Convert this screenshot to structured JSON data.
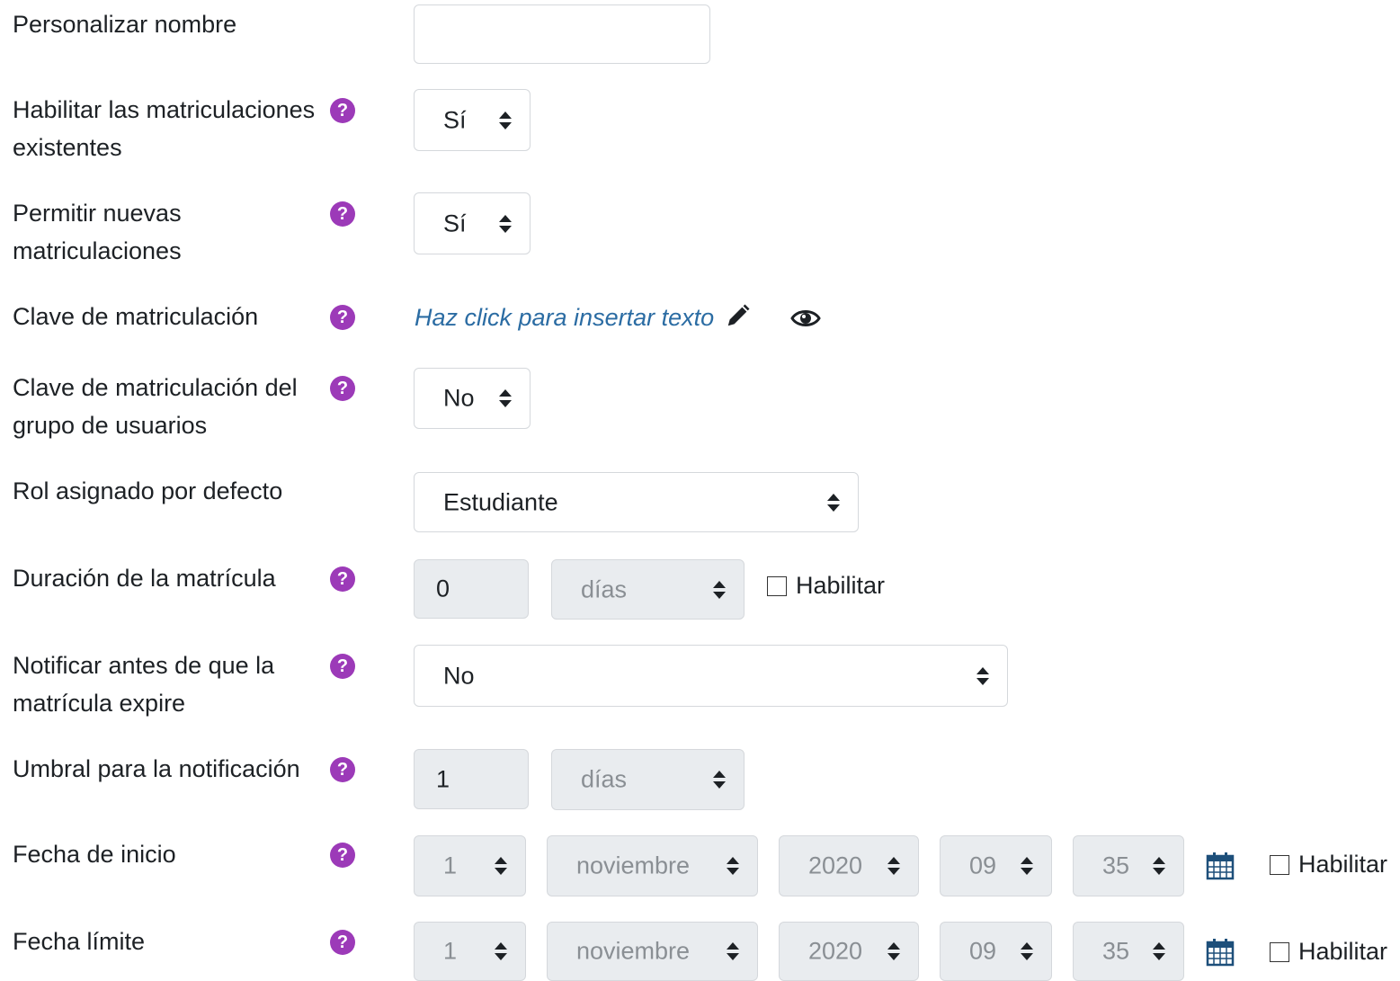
{
  "form": {
    "custom_name": {
      "label": "Personalizar nombre",
      "value": ""
    },
    "enable_existing": {
      "label": "Habilitar las matriculaciones existentes",
      "value": "Sí"
    },
    "allow_new": {
      "label": "Permitir nuevas matriculaciones",
      "value": "Sí"
    },
    "enrol_key": {
      "label": "Clave de matriculación",
      "link_text": "Haz click para insertar texto"
    },
    "group_key": {
      "label": "Clave de matriculación del grupo de usuarios",
      "value": "No"
    },
    "default_role": {
      "label": "Rol asignado por defecto",
      "value": "Estudiante"
    },
    "duration": {
      "label": "Duración de la matrícula",
      "number": "0",
      "unit": "días",
      "enable_label": "Habilitar"
    },
    "notify": {
      "label": "Notificar antes de que la matrícula expire",
      "value": "No"
    },
    "threshold": {
      "label": "Umbral para la notificación",
      "number": "1",
      "unit": "días"
    },
    "start_date": {
      "label": "Fecha de inicio",
      "day": "1",
      "month": "noviembre",
      "year": "2020",
      "hour": "09",
      "minute": "35",
      "enable_label": "Habilitar"
    },
    "end_date": {
      "label": "Fecha límite",
      "day": "1",
      "month": "noviembre",
      "year": "2020",
      "hour": "09",
      "minute": "35",
      "enable_label": "Habilitar"
    }
  },
  "icons": {
    "help": "question-circle-icon",
    "edit": "pencil-icon",
    "view": "eye-icon",
    "calendar": "calendar-icon"
  },
  "colors": {
    "help_icon": "#9c3ab8",
    "link": "#2b6ca3",
    "disabled_bg": "#e9ecef"
  }
}
